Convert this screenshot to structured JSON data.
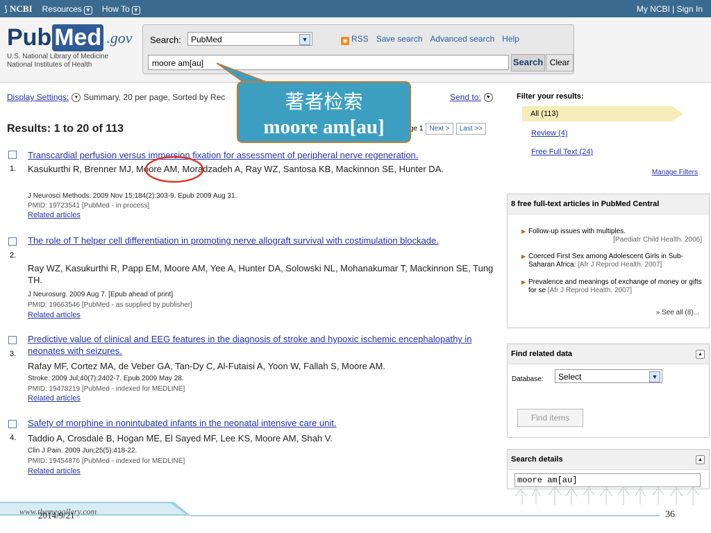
{
  "ncbi_bar": {
    "logo": "NCBI",
    "resources": "Resources",
    "how_to": "How To",
    "account": "My NCBI | Sign In"
  },
  "header": {
    "logo_pub": "Pub",
    "logo_med": "Med",
    "logo_gov": ".gov",
    "sub1": "U.S. National Library of Medicine",
    "sub2": "National Institutes of Health",
    "search_label": "Search:",
    "database": "PubMed",
    "links": [
      "RSS",
      "Save search",
      "Advanced search",
      "Help"
    ],
    "query": "moore am[au]",
    "search_button": "Search",
    "clear_button": "Clear"
  },
  "toolbar": {
    "display_settings": "Display Settings:",
    "display_summary": "Summary, 20 per page, Sorted by Rec",
    "send_to": "Send to:"
  },
  "results_header": {
    "title": "Results: 1 to 20 of 113",
    "page_text": "ge 1",
    "next": "Next >",
    "last": "Last >>"
  },
  "results": [
    {
      "number": "1.",
      "title": "Transcardial perfusion versus immersion fixation for assessment of peripheral nerve regeneration.",
      "authors": "Kasukurthi R, Brenner MJ, Moore AM, Moradzadeh A, Ray WZ, Santosa KB, Mackinnon SE, Hunter DA.",
      "journal": "J Neurosci Methods. 2009 Nov 15;184(2):303-9. Epub 2009 Aug 31.",
      "pmid": "PMID: 19723541 [PubMed - in process]",
      "related": "Related articles"
    },
    {
      "number": "2.",
      "title": "The role of T helper cell differentiation in promoting nerve allograft survival with costimulation blockade.",
      "authors": "Ray WZ, Kasukurthi R, Papp EM, Moore AM, Yee A, Hunter DA, Solowski NL, Mohanakumar T, Mackinnon SE, Tung TH.",
      "journal": "J Neurosurg. 2009 Aug 7. [Epub ahead of print]",
      "pmid": "PMID: 19663546 [PubMed - as supplied by publisher]",
      "related": "Related articles"
    },
    {
      "number": "3.",
      "title": "Predictive value of clinical and EEG features in the diagnosis of stroke and hypoxic ischemic encephalopathy in neonates with seizures.",
      "authors": "Rafay MF, Cortez MA, de Veber GA, Tan-Dy C, Al-Futaisi A, Yoon W, Fallah S, Moore AM.",
      "journal": "Stroke. 2009 Jul;40(7):2402-7. Epub 2009 May 28.",
      "pmid": "PMID: 19478219 [PubMed - indexed for MEDLINE]",
      "related": "Related articles"
    },
    {
      "number": "4.",
      "title": "Safety of morphine in nonintubated infants in the neonatal intensive care unit.",
      "authors": "Taddio A, Crosdale B, Hogan ME, El Sayed MF, Lee KS, Moore AM, Shah V.",
      "journal": "Clin J Pain. 2009 Jun;25(5):418-22.",
      "pmid": "PMID: 19454876 [PubMed - indexed for MEDLINE]",
      "related": "Related articles"
    }
  ],
  "filters": {
    "title": "Filter your results:",
    "all": "All (113)",
    "review": "Review (4)",
    "free_full_text": "Free Full Text (24)",
    "manage": "Manage Filters"
  },
  "pmc_box": {
    "title": "8 free full-text articles in PubMed Central",
    "items": [
      {
        "text": "Follow-up issues with multiples.",
        "source": "[Paediatr Child Health. 2006]"
      },
      {
        "text": "Coerced First Sex among Adolescent Girls in Sub-Saharan Africa:",
        "source": "[Afr J Reprod Health. 2007]"
      },
      {
        "text": "Prevalence and meanings of exchange of money or gifts for se",
        "source": "[Afr J Reprod Health. 2007]"
      }
    ],
    "see_all": "» See all (8)..."
  },
  "related_data": {
    "title": "Find related data",
    "db_label": "Database:",
    "db_value": "Select",
    "find_button": "Find items"
  },
  "search_details": {
    "title": "Search details",
    "query": "moore am[au]"
  },
  "annotation": {
    "line1": "著者检索",
    "line2": "moore am[au]"
  },
  "footer": {
    "url": "www.themegallery.com",
    "date": "2014/9/21",
    "page": "36"
  },
  "colors": {
    "ncbi_bar": "#3a6a8f",
    "link": "#2233aa",
    "callout_fill": "#3c9fc2",
    "callout_border": "#c7792f",
    "highlight_circle": "#d93a2b",
    "filter_selected": "#f6ecb8"
  }
}
